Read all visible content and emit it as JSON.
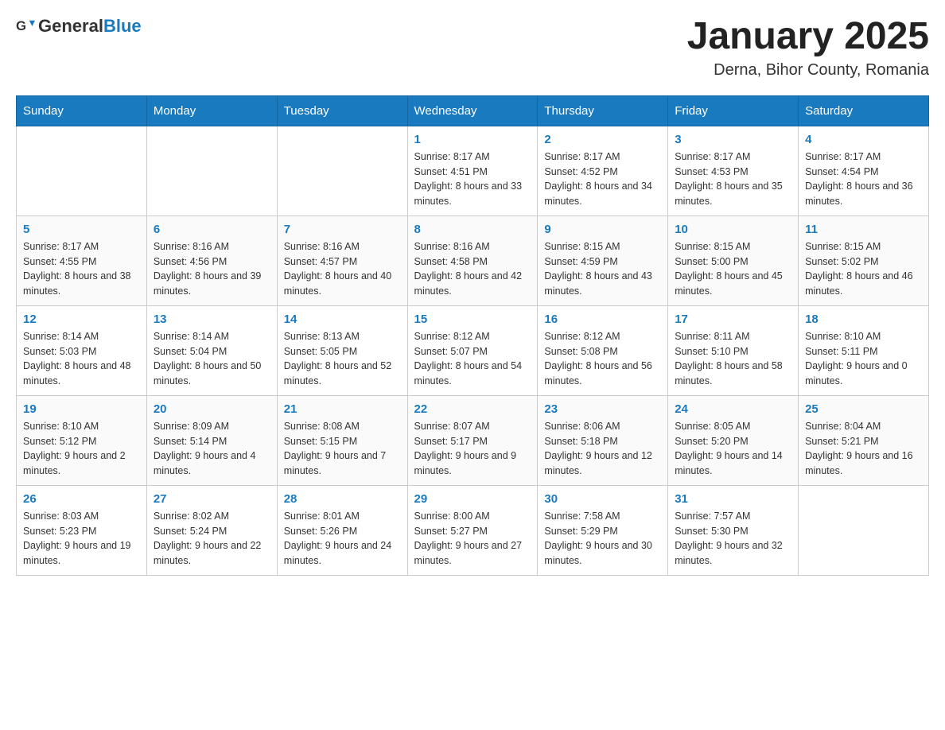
{
  "header": {
    "logo_general": "General",
    "logo_blue": "Blue",
    "month_title": "January 2025",
    "location": "Derna, Bihor County, Romania"
  },
  "weekdays": [
    "Sunday",
    "Monday",
    "Tuesday",
    "Wednesday",
    "Thursday",
    "Friday",
    "Saturday"
  ],
  "weeks": [
    [
      {
        "day": "",
        "sunrise": "",
        "sunset": "",
        "daylight": ""
      },
      {
        "day": "",
        "sunrise": "",
        "sunset": "",
        "daylight": ""
      },
      {
        "day": "",
        "sunrise": "",
        "sunset": "",
        "daylight": ""
      },
      {
        "day": "1",
        "sunrise": "Sunrise: 8:17 AM",
        "sunset": "Sunset: 4:51 PM",
        "daylight": "Daylight: 8 hours and 33 minutes."
      },
      {
        "day": "2",
        "sunrise": "Sunrise: 8:17 AM",
        "sunset": "Sunset: 4:52 PM",
        "daylight": "Daylight: 8 hours and 34 minutes."
      },
      {
        "day": "3",
        "sunrise": "Sunrise: 8:17 AM",
        "sunset": "Sunset: 4:53 PM",
        "daylight": "Daylight: 8 hours and 35 minutes."
      },
      {
        "day": "4",
        "sunrise": "Sunrise: 8:17 AM",
        "sunset": "Sunset: 4:54 PM",
        "daylight": "Daylight: 8 hours and 36 minutes."
      }
    ],
    [
      {
        "day": "5",
        "sunrise": "Sunrise: 8:17 AM",
        "sunset": "Sunset: 4:55 PM",
        "daylight": "Daylight: 8 hours and 38 minutes."
      },
      {
        "day": "6",
        "sunrise": "Sunrise: 8:16 AM",
        "sunset": "Sunset: 4:56 PM",
        "daylight": "Daylight: 8 hours and 39 minutes."
      },
      {
        "day": "7",
        "sunrise": "Sunrise: 8:16 AM",
        "sunset": "Sunset: 4:57 PM",
        "daylight": "Daylight: 8 hours and 40 minutes."
      },
      {
        "day": "8",
        "sunrise": "Sunrise: 8:16 AM",
        "sunset": "Sunset: 4:58 PM",
        "daylight": "Daylight: 8 hours and 42 minutes."
      },
      {
        "day": "9",
        "sunrise": "Sunrise: 8:15 AM",
        "sunset": "Sunset: 4:59 PM",
        "daylight": "Daylight: 8 hours and 43 minutes."
      },
      {
        "day": "10",
        "sunrise": "Sunrise: 8:15 AM",
        "sunset": "Sunset: 5:00 PM",
        "daylight": "Daylight: 8 hours and 45 minutes."
      },
      {
        "day": "11",
        "sunrise": "Sunrise: 8:15 AM",
        "sunset": "Sunset: 5:02 PM",
        "daylight": "Daylight: 8 hours and 46 minutes."
      }
    ],
    [
      {
        "day": "12",
        "sunrise": "Sunrise: 8:14 AM",
        "sunset": "Sunset: 5:03 PM",
        "daylight": "Daylight: 8 hours and 48 minutes."
      },
      {
        "day": "13",
        "sunrise": "Sunrise: 8:14 AM",
        "sunset": "Sunset: 5:04 PM",
        "daylight": "Daylight: 8 hours and 50 minutes."
      },
      {
        "day": "14",
        "sunrise": "Sunrise: 8:13 AM",
        "sunset": "Sunset: 5:05 PM",
        "daylight": "Daylight: 8 hours and 52 minutes."
      },
      {
        "day": "15",
        "sunrise": "Sunrise: 8:12 AM",
        "sunset": "Sunset: 5:07 PM",
        "daylight": "Daylight: 8 hours and 54 minutes."
      },
      {
        "day": "16",
        "sunrise": "Sunrise: 8:12 AM",
        "sunset": "Sunset: 5:08 PM",
        "daylight": "Daylight: 8 hours and 56 minutes."
      },
      {
        "day": "17",
        "sunrise": "Sunrise: 8:11 AM",
        "sunset": "Sunset: 5:10 PM",
        "daylight": "Daylight: 8 hours and 58 minutes."
      },
      {
        "day": "18",
        "sunrise": "Sunrise: 8:10 AM",
        "sunset": "Sunset: 5:11 PM",
        "daylight": "Daylight: 9 hours and 0 minutes."
      }
    ],
    [
      {
        "day": "19",
        "sunrise": "Sunrise: 8:10 AM",
        "sunset": "Sunset: 5:12 PM",
        "daylight": "Daylight: 9 hours and 2 minutes."
      },
      {
        "day": "20",
        "sunrise": "Sunrise: 8:09 AM",
        "sunset": "Sunset: 5:14 PM",
        "daylight": "Daylight: 9 hours and 4 minutes."
      },
      {
        "day": "21",
        "sunrise": "Sunrise: 8:08 AM",
        "sunset": "Sunset: 5:15 PM",
        "daylight": "Daylight: 9 hours and 7 minutes."
      },
      {
        "day": "22",
        "sunrise": "Sunrise: 8:07 AM",
        "sunset": "Sunset: 5:17 PM",
        "daylight": "Daylight: 9 hours and 9 minutes."
      },
      {
        "day": "23",
        "sunrise": "Sunrise: 8:06 AM",
        "sunset": "Sunset: 5:18 PM",
        "daylight": "Daylight: 9 hours and 12 minutes."
      },
      {
        "day": "24",
        "sunrise": "Sunrise: 8:05 AM",
        "sunset": "Sunset: 5:20 PM",
        "daylight": "Daylight: 9 hours and 14 minutes."
      },
      {
        "day": "25",
        "sunrise": "Sunrise: 8:04 AM",
        "sunset": "Sunset: 5:21 PM",
        "daylight": "Daylight: 9 hours and 16 minutes."
      }
    ],
    [
      {
        "day": "26",
        "sunrise": "Sunrise: 8:03 AM",
        "sunset": "Sunset: 5:23 PM",
        "daylight": "Daylight: 9 hours and 19 minutes."
      },
      {
        "day": "27",
        "sunrise": "Sunrise: 8:02 AM",
        "sunset": "Sunset: 5:24 PM",
        "daylight": "Daylight: 9 hours and 22 minutes."
      },
      {
        "day": "28",
        "sunrise": "Sunrise: 8:01 AM",
        "sunset": "Sunset: 5:26 PM",
        "daylight": "Daylight: 9 hours and 24 minutes."
      },
      {
        "day": "29",
        "sunrise": "Sunrise: 8:00 AM",
        "sunset": "Sunset: 5:27 PM",
        "daylight": "Daylight: 9 hours and 27 minutes."
      },
      {
        "day": "30",
        "sunrise": "Sunrise: 7:58 AM",
        "sunset": "Sunset: 5:29 PM",
        "daylight": "Daylight: 9 hours and 30 minutes."
      },
      {
        "day": "31",
        "sunrise": "Sunrise: 7:57 AM",
        "sunset": "Sunset: 5:30 PM",
        "daylight": "Daylight: 9 hours and 32 minutes."
      },
      {
        "day": "",
        "sunrise": "",
        "sunset": "",
        "daylight": ""
      }
    ]
  ]
}
